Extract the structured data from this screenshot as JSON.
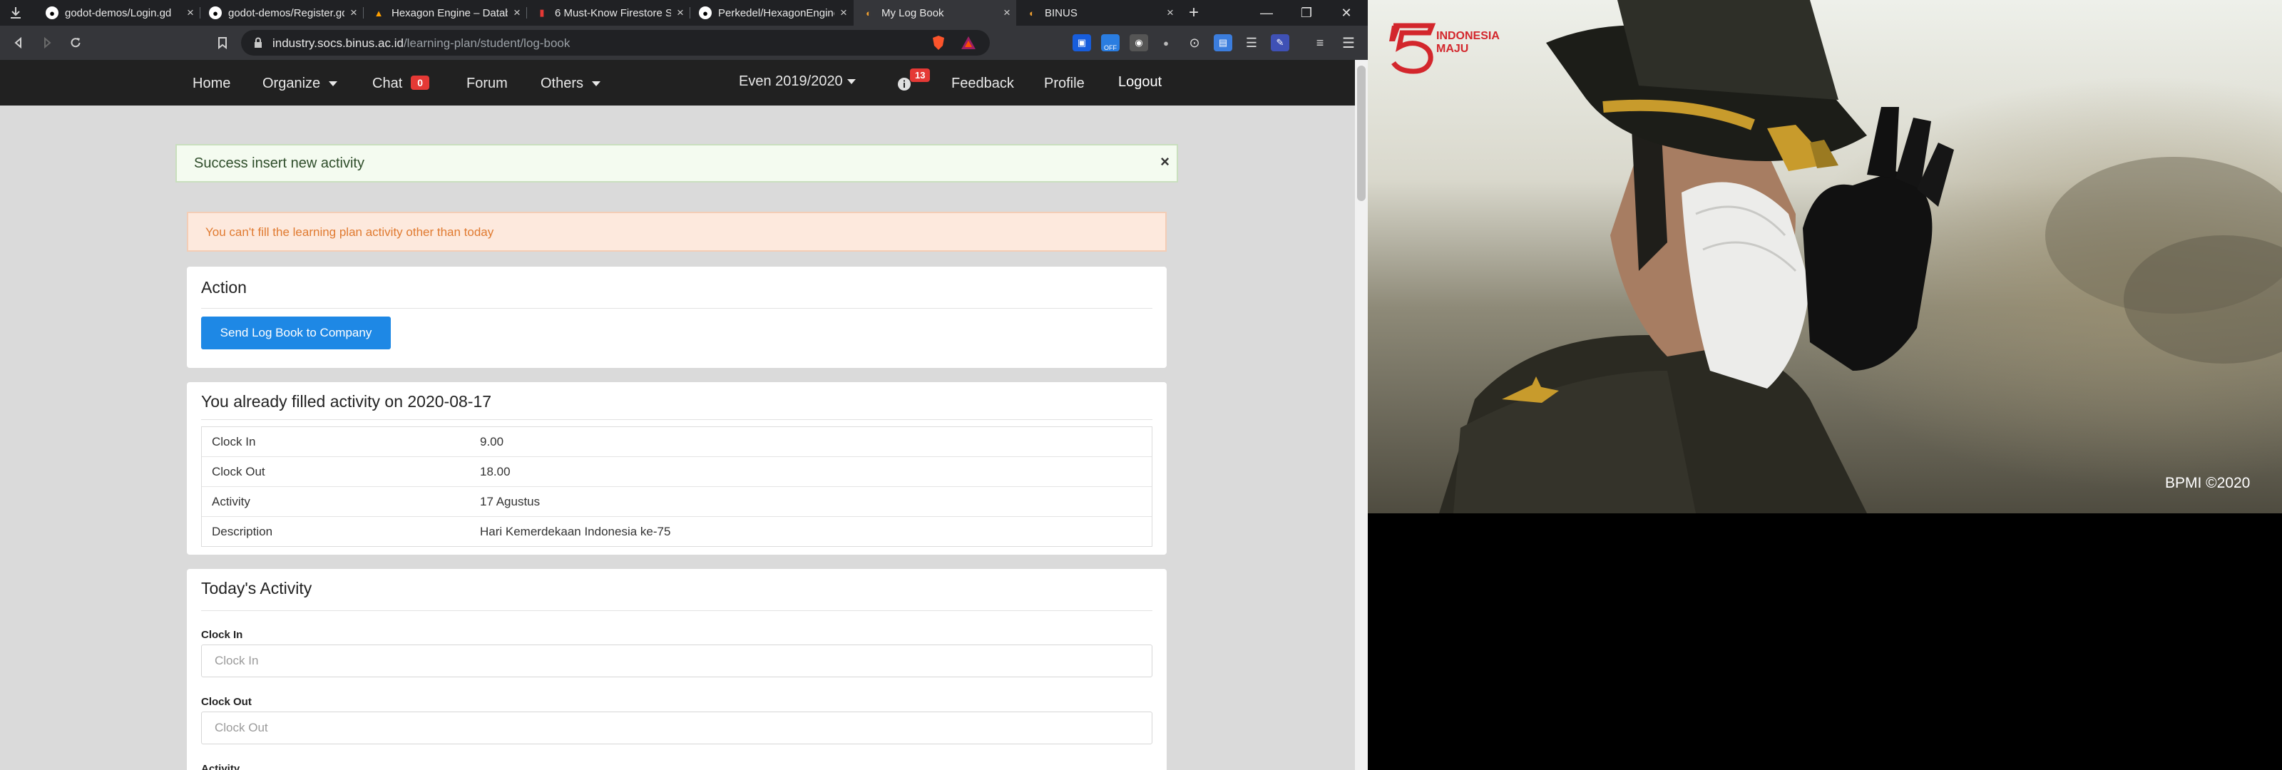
{
  "tabs": [
    {
      "title": "godot-demos/Login.gd",
      "icon": "github-icon"
    },
    {
      "title": "godot-demos/Register.gd",
      "icon": "github-icon"
    },
    {
      "title": "Hexagon Engine – Datab",
      "icon": "firebase-icon"
    },
    {
      "title": "6 Must-Know Firestore S",
      "icon": "firestore-icon"
    },
    {
      "title": "Perkedel/HexagonEngine",
      "icon": "github-icon"
    },
    {
      "title": "My Log Book",
      "icon": "binus-icon"
    },
    {
      "title": "BINUS",
      "icon": "binus-icon"
    }
  ],
  "new_tab_label": "+",
  "window_controls": {
    "minimize": "—",
    "restore": "❐",
    "close": "✕"
  },
  "address": {
    "domain": "industry.socs.binus.ac.id",
    "path": "/learning-plan/student/log-book"
  },
  "extension_badge": "OFF",
  "nav": {
    "home": "Home",
    "organize": "Organize",
    "chat": "Chat",
    "chat_count": "0",
    "forum": "Forum",
    "others": "Others",
    "term": "Even 2019/2020",
    "notif_count": "13",
    "feedback": "Feedback",
    "profile": "Profile",
    "logout": "Logout"
  },
  "alerts": {
    "success": "Success insert new activity",
    "success_close": "×",
    "warning": "You can't fill the learning plan activity other than today"
  },
  "action_card": {
    "title": "Action",
    "button": "Send Log Book to Company"
  },
  "filled_card": {
    "title": "You already filled activity on 2020-08-17",
    "rows": [
      {
        "key": "Clock In",
        "value": "9.00"
      },
      {
        "key": "Clock Out",
        "value": "18.00"
      },
      {
        "key": "Activity",
        "value": "17 Agustus"
      },
      {
        "key": "Description",
        "value": "Hari Kemerdekaan Indonesia ke-75"
      }
    ]
  },
  "today_card": {
    "title": "Today's Activity",
    "clock_in_label": "Clock In",
    "clock_in_placeholder": "Clock In",
    "clock_out_label": "Clock Out",
    "clock_out_placeholder": "Clock Out",
    "activity_label": "Activity"
  },
  "video": {
    "logo_number": "75",
    "logo_line1": "INDONESIA",
    "logo_line2": "MAJU",
    "credit": "BPMI ©2020"
  },
  "colors": {
    "primary": "#1e88e5",
    "badge_red": "#e53935",
    "navbar": "#212121",
    "logo_red": "#d3262c"
  }
}
